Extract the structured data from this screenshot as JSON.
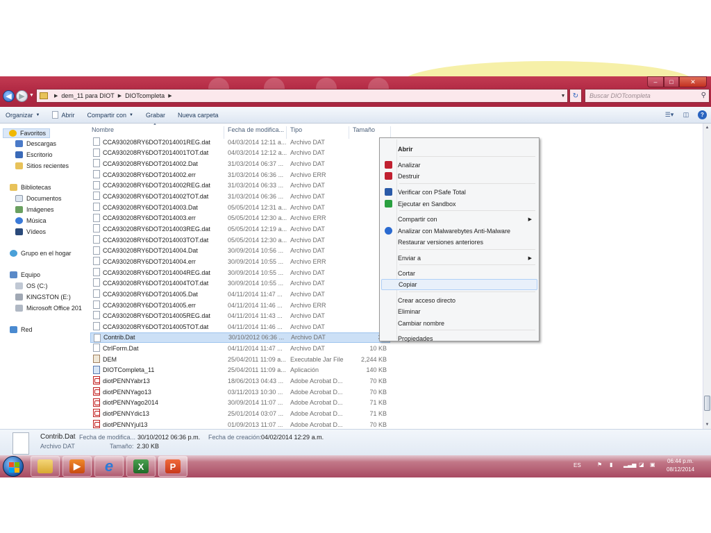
{
  "window": {
    "breadcrumb": [
      "dem_11 para DIOT",
      "DIOTcompleta"
    ],
    "search_placeholder": "Buscar DIOTcompleta"
  },
  "toolbar": {
    "organize": "Organizar",
    "open": "Abrir",
    "share": "Compartir con",
    "burn": "Grabar",
    "new_folder": "Nueva carpeta"
  },
  "nav": {
    "favorites": "Favoritos",
    "downloads": "Descargas",
    "desktop": "Escritorio",
    "recent": "Sitios recientes",
    "libraries": "Bibliotecas",
    "documents": "Documentos",
    "pictures": "Imágenes",
    "music": "Música",
    "videos": "Vídeos",
    "homegroup": "Grupo en el hogar",
    "computer": "Equipo",
    "os_drive": "OS (C:)",
    "kingston": "KINGSTON (E:)",
    "office": "Microsoft Office 201",
    "network": "Red"
  },
  "columns": {
    "name": "Nombre",
    "date": "Fecha de modifica...",
    "type": "Tipo",
    "size": "Tamaño"
  },
  "files": [
    {
      "name": "CCA930208RY6DOT2014001REG.dat",
      "date": "04/03/2014 12:11 a...",
      "type": "Archivo DAT",
      "size": "1",
      "icon": "file-icon"
    },
    {
      "name": "CCA930208RY6DOT2014001TOT.dat",
      "date": "04/03/2014 12:12 a...",
      "type": "Archivo DAT",
      "size": "1",
      "icon": "file-icon"
    },
    {
      "name": "CCA930208RY6DOT2014002.Dat",
      "date": "31/03/2014 06:37 ...",
      "type": "Archivo DAT",
      "size": "9",
      "icon": "file-icon"
    },
    {
      "name": "CCA930208RY6DOT2014002.err",
      "date": "31/03/2014 06:36 ...",
      "type": "Archivo ERR",
      "size": "0",
      "icon": "file-icon"
    },
    {
      "name": "CCA930208RY6DOT2014002REG.dat",
      "date": "31/03/2014 06:33 ...",
      "type": "Archivo DAT",
      "size": "1",
      "icon": "file-icon"
    },
    {
      "name": "CCA930208RY6DOT2014002TOT.dat",
      "date": "31/03/2014 06:36 ...",
      "type": "Archivo DAT",
      "size": "1",
      "icon": "file-icon"
    },
    {
      "name": "CCA930208RY6DOT2014003.Dat",
      "date": "05/05/2014 12:31 a...",
      "type": "Archivo DAT",
      "size": "10",
      "icon": "file-icon"
    },
    {
      "name": "CCA930208RY6DOT2014003.err",
      "date": "05/05/2014 12:30 a...",
      "type": "Archivo ERR",
      "size": "0",
      "icon": "file-icon"
    },
    {
      "name": "CCA930208RY6DOT2014003REG.dat",
      "date": "05/05/2014 12:19 a...",
      "type": "Archivo DAT",
      "size": "1",
      "icon": "file-icon"
    },
    {
      "name": "CCA930208RY6DOT2014003TOT.dat",
      "date": "05/05/2014 12:30 a...",
      "type": "Archivo DAT",
      "size": "1",
      "icon": "file-icon"
    },
    {
      "name": "CCA930208RY6DOT2014004.Dat",
      "date": "30/09/2014 10:56 ...",
      "type": "Archivo DAT",
      "size": "7",
      "icon": "file-icon"
    },
    {
      "name": "CCA930208RY6DOT2014004.err",
      "date": "30/09/2014 10:55 ...",
      "type": "Archivo ERR",
      "size": "0",
      "icon": "file-icon"
    },
    {
      "name": "CCA930208RY6DOT2014004REG.dat",
      "date": "30/09/2014 10:55 ...",
      "type": "Archivo DAT",
      "size": "1",
      "icon": "file-icon"
    },
    {
      "name": "CCA930208RY6DOT2014004TOT.dat",
      "date": "30/09/2014 10:55 ...",
      "type": "Archivo DAT",
      "size": "1",
      "icon": "file-icon"
    },
    {
      "name": "CCA930208RY6DOT2014005.Dat",
      "date": "04/11/2014 11:47 ...",
      "type": "Archivo DAT",
      "size": "10",
      "icon": "file-icon"
    },
    {
      "name": "CCA930208RY6DOT2014005.err",
      "date": "04/11/2014 11:46 ...",
      "type": "Archivo ERR",
      "size": "0",
      "icon": "file-icon"
    },
    {
      "name": "CCA930208RY6DOT2014005REG.dat",
      "date": "04/11/2014 11:43 ...",
      "type": "Archivo DAT",
      "size": "1",
      "icon": "file-icon"
    },
    {
      "name": "CCA930208RY6DOT2014005TOT.dat",
      "date": "04/11/2014 11:46 ...",
      "type": "Archivo DAT",
      "size": "1",
      "icon": "file-icon"
    },
    {
      "name": "Contrib.Dat",
      "date": "30/10/2012 06:36 ...",
      "type": "Archivo DAT",
      "size": "3 K",
      "icon": "file-icon",
      "selected": true
    },
    {
      "name": "CtrlForm.Dat",
      "date": "04/11/2014 11:47 ...",
      "type": "Archivo DAT",
      "size": "10 KB",
      "icon": "file-icon"
    },
    {
      "name": "DEM",
      "date": "25/04/2011 11:09 a...",
      "type": "Executable Jar File",
      "size": "2,244 KB",
      "icon": "jar-icon"
    },
    {
      "name": "DIOTCompleta_11",
      "date": "25/04/2011 11:09 a...",
      "type": "Aplicación",
      "size": "140 KB",
      "icon": "application-icon"
    },
    {
      "name": "diotPENNYabr13",
      "date": "18/06/2013 04:43 ...",
      "type": "Adobe Acrobat D...",
      "size": "70 KB",
      "icon": "pdf-icon"
    },
    {
      "name": "diotPENNYago13",
      "date": "03/11/2013 10:30 ...",
      "type": "Adobe Acrobat D...",
      "size": "70 KB",
      "icon": "pdf-icon"
    },
    {
      "name": "diotPENNYago2014",
      "date": "30/09/2014 11:07 ...",
      "type": "Adobe Acrobat D...",
      "size": "71 KB",
      "icon": "pdf-icon"
    },
    {
      "name": "diotPENNYdic13",
      "date": "25/01/2014 03:07 ...",
      "type": "Adobe Acrobat D...",
      "size": "71 KB",
      "icon": "pdf-icon"
    },
    {
      "name": "diotPENNYjul13",
      "date": "01/09/2013 11:07 ...",
      "type": "Adobe Acrobat D...",
      "size": "70 KB",
      "icon": "pdf-icon"
    }
  ],
  "context_menu": {
    "items": [
      {
        "label": "Abrir",
        "bold": true
      },
      {
        "label": "Analizar",
        "icon": "shield-icon"
      },
      {
        "label": "Destruir",
        "icon": "shield-icon"
      },
      {
        "label": "Verificar con PSafe Total",
        "icon": "psafe-shield-icon"
      },
      {
        "label": "Ejecutar en Sandbox",
        "icon": "sandbox-icon"
      },
      {
        "label": "Compartir con",
        "submenu": true
      },
      {
        "label": "Analizar con Malwarebytes Anti-Malware",
        "icon": "malwarebytes-icon"
      },
      {
        "label": "Restaurar versiones anteriores"
      },
      {
        "label": "Enviar a",
        "submenu": true
      },
      {
        "label": "Cortar"
      },
      {
        "label": "Copiar",
        "highlighted": true
      },
      {
        "label": "Crear acceso directo"
      },
      {
        "label": "Eliminar"
      },
      {
        "label": "Cambiar nombre"
      },
      {
        "label": "Propiedades"
      }
    ]
  },
  "details": {
    "filename": "Contrib.Dat",
    "type": "Archivo DAT",
    "modified_label": "Fecha de modifica...",
    "modified_value": "30/10/2012 06:36 p.m.",
    "created_label": "Fecha de creación:",
    "created_value": "04/02/2014 12:29 a.m.",
    "size_label": "Tamaño:",
    "size_value": "2.30 KB"
  },
  "taskbar": {
    "language": "ES",
    "time": "06:44 p.m.",
    "date": "08/12/2014"
  },
  "colors": {
    "titlebar": "#b22a44",
    "taskbar": "#a84a62",
    "selection": "#cce0f6",
    "accent": "#2a64c0"
  }
}
